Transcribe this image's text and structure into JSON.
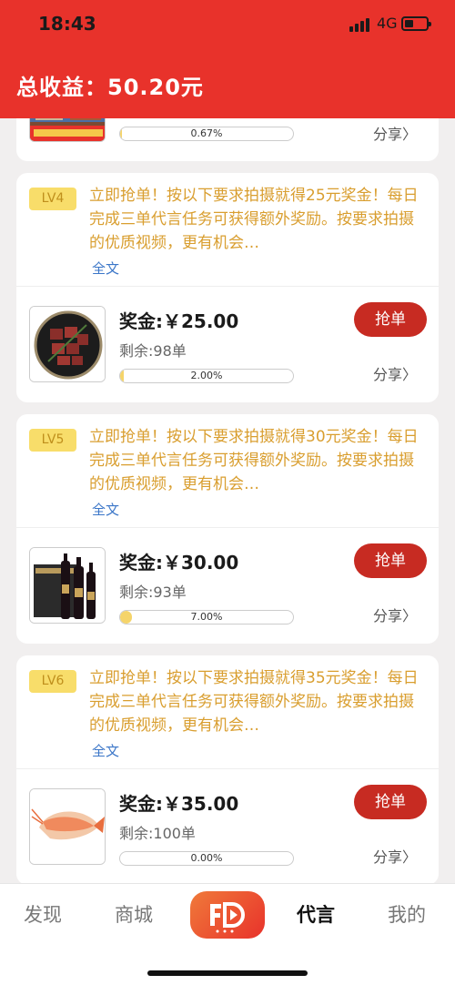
{
  "status_bar": {
    "time": "18:43",
    "network": "4G"
  },
  "header": {
    "total_label": "总收益：50.20元"
  },
  "partial_card": {
    "progress_text": "0.67%",
    "progress": 0.0067,
    "share": "分享"
  },
  "tasks": [
    {
      "level": "LV4",
      "description": "立即抢单！按以下要求拍摄就得25元奖金！每日完成三单代言任务可获得额外奖励。按要求拍摄的优质视频，更有机会…",
      "full_text": "全文",
      "bonus": "奖金:￥25.00",
      "remaining": "剩余:98单",
      "progress_text": "2.00%",
      "progress": 0.02,
      "grab_button": "抢单",
      "share": "分享"
    },
    {
      "level": "LV5",
      "description": "立即抢单！按以下要求拍摄就得30元奖金！每日完成三单代言任务可获得额外奖励。按要求拍摄的优质视频，更有机会…",
      "full_text": "全文",
      "bonus": "奖金:￥30.00",
      "remaining": "剩余:93单",
      "progress_text": "7.00%",
      "progress": 0.07,
      "grab_button": "抢单",
      "share": "分享"
    },
    {
      "level": "LV6",
      "description": "立即抢单！按以下要求拍摄就得35元奖金！每日完成三单代言任务可获得额外奖励。按要求拍摄的优质视频，更有机会…",
      "full_text": "全文",
      "bonus": "奖金:￥35.00",
      "remaining": "剩余:100单",
      "progress_text": "0.00%",
      "progress": 0,
      "grab_button": "抢单",
      "share": "分享"
    }
  ],
  "tabbar": {
    "items": [
      {
        "label": "发现",
        "active": false
      },
      {
        "label": "商城",
        "active": false
      },
      {
        "label": "代言",
        "active": true
      },
      {
        "label": "我的",
        "active": false
      }
    ],
    "center_icon": "fd-logo-icon"
  },
  "colors": {
    "brand_red": "#e8322b",
    "level_badge": "#f8dd6a",
    "description": "#d99e2f",
    "link": "#3b76c8",
    "grab_button": "#c72b22"
  }
}
